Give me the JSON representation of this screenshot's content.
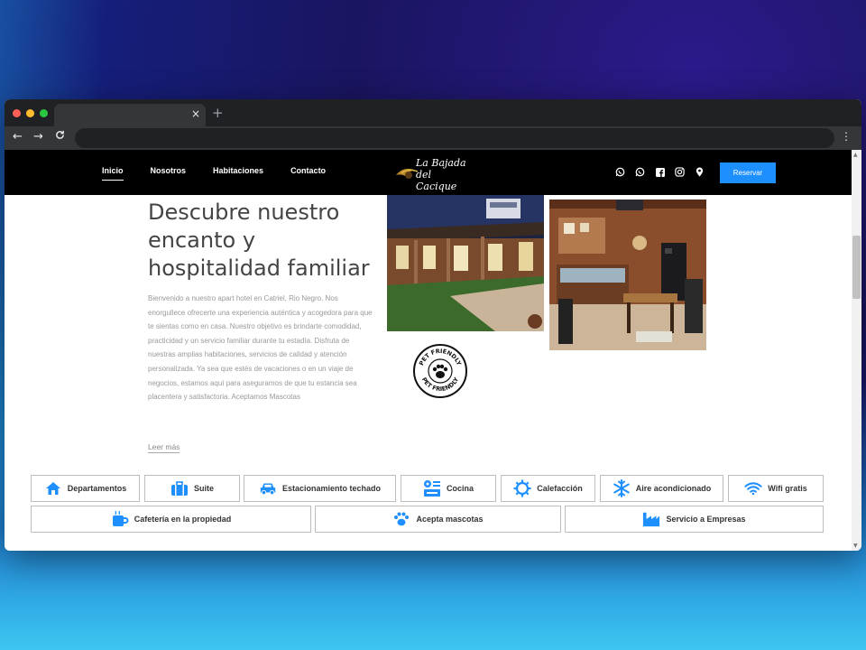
{
  "site": {
    "nav": {
      "items": [
        {
          "label": "Inicio"
        },
        {
          "label": "Nosotros"
        },
        {
          "label": "Habitaciones"
        },
        {
          "label": "Contacto"
        }
      ],
      "logo_line1": "La Bajada",
      "logo_line2": "del Cacique",
      "reserve_label": "Reservar"
    },
    "hero": {
      "title": "Descubre nuestro encanto y hospitalidad familiar",
      "body": "Bienvenido a nuestro apart hotel en Catriel, Rio Negro. Nos enorgullece ofrecerte una experiencia auténtica y acogedora para que te sientas como en casa. Nuestro objetivo es brindarte comodidad, practicidad y un servicio familiar durante tu estadía. Disfruta de nuestras amplias habitaciones, servicios de calidad y atención personalizada. Ya sea que estés de vacaciones o en un viaje de negocios, estamos aquí para aseguramos de que tu estancia sea placentera y satisfactoria. Aceptamos Mascotas",
      "read_more": "Leer más",
      "pet_badge_top": "PET FRIENDLY",
      "pet_badge_bottom": "PET FRIENDLY"
    },
    "features": [
      {
        "label": "Departamentos",
        "icon": "home-icon"
      },
      {
        "label": "Suite",
        "icon": "suitcase-icon"
      },
      {
        "label": "Estacionamiento techado",
        "icon": "car-icon"
      },
      {
        "label": "Cocina",
        "icon": "stove-icon"
      },
      {
        "label": "Calefacción",
        "icon": "sun-heat-icon"
      },
      {
        "label": "Aire acondicionado",
        "icon": "snowflake-icon"
      },
      {
        "label": "Wifi gratis",
        "icon": "wifi-icon"
      },
      {
        "label": "Cafetería en la propiedad",
        "icon": "coffee-icon"
      },
      {
        "label": "Acepta mascotas",
        "icon": "paw-icon"
      },
      {
        "label": "Servicio a Empresas",
        "icon": "factory-icon"
      }
    ],
    "colors": {
      "accent": "#1e8fff",
      "nav_bg": "#000000"
    }
  },
  "browser": {
    "tab_close": "×",
    "new_tab": "+",
    "back": "←",
    "forward": "→",
    "reload": "C",
    "menu": "⋮"
  }
}
